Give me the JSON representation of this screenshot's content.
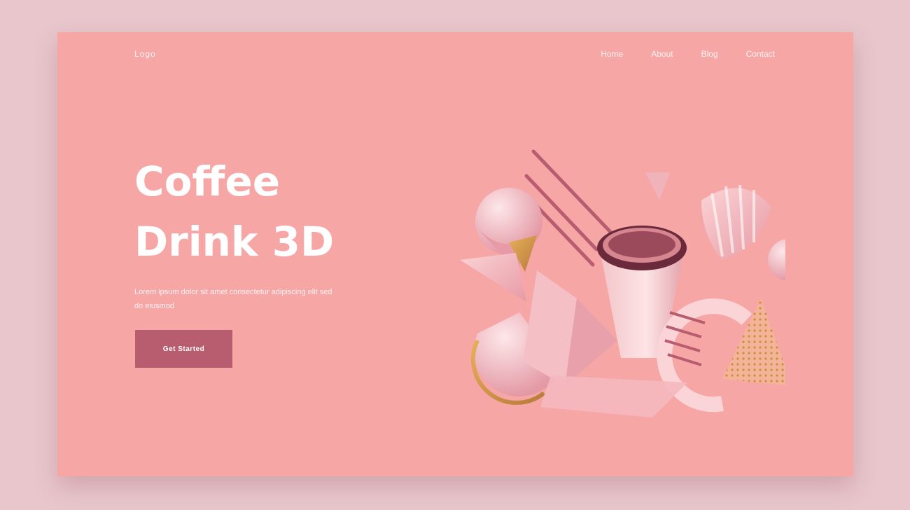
{
  "page": {
    "background": "#e8c6cc",
    "card_color": "#f7a6a6",
    "accent": "#b85c70"
  },
  "nav": {
    "logo": "Logo",
    "items": [
      {
        "label": "Home"
      },
      {
        "label": "About"
      },
      {
        "label": "Blog"
      },
      {
        "label": "Contact"
      }
    ]
  },
  "hero": {
    "title_line1": "Coffee",
    "title_line2": "Drink 3D",
    "subtitle": "Lorem ipsum dolor sit amet consectetur adipiscing elit sed do eiusmod",
    "cta_label": "Get Started"
  },
  "illustration": {
    "icon": "coffee-cup-3d-illustration"
  }
}
